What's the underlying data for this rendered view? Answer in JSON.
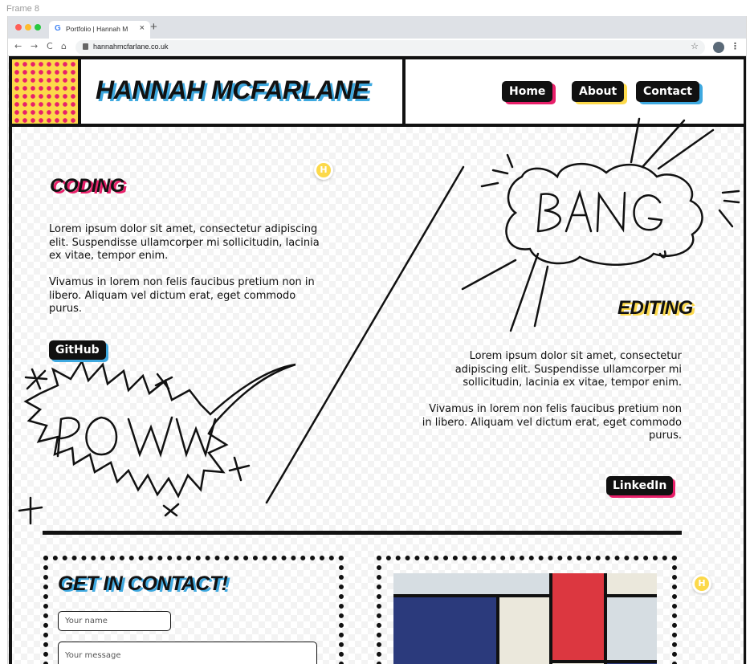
{
  "frame_label": "Frame 8",
  "browser": {
    "tab_title": "Portfolio | Hannah M",
    "tab_close": "×",
    "new_tab": "+",
    "url": "hannahmcfarlane.co.uk",
    "nav": {
      "back": "←",
      "forward": "→",
      "reload": "C",
      "home": "⌂",
      "star": "☆",
      "menu": "⋮"
    }
  },
  "header": {
    "site_title": "HANNAH MCFARLANE",
    "nav": [
      {
        "label": "Home"
      },
      {
        "label": "About"
      },
      {
        "label": "Contact"
      }
    ]
  },
  "coding": {
    "heading": "CODING",
    "para1": "Lorem ipsum dolor sit amet, consectetur adipiscing elit. Suspendisse ullamcorper mi sollicitudin, lacinia ex vitae, tempor enim.",
    "para2": "Vivamus in lorem non felis faucibus pretium non in libero. Aliquam vel dictum erat, eget commodo purus.",
    "button": "GitHub",
    "doodle_text": "POW"
  },
  "editing": {
    "heading": "EDITING",
    "para1": "Lorem ipsum dolor sit amet, consectetur adipiscing elit. Suspendisse ullamcorper mi sollicitudin, lacinia ex vitae, tempor enim.",
    "para2": "Vivamus in lorem non felis faucibus pretium non in libero. Aliquam vel dictum erat, eget commodo purus.",
    "button": "LinkedIn",
    "doodle_text": "BANG"
  },
  "contact": {
    "heading": "GET IN CONTACT!",
    "name_placeholder": "Your name",
    "message_placeholder": "Your message"
  },
  "markers": {
    "label": "H"
  },
  "colors": {
    "pink": "#e8206a",
    "yellow": "#fcd94a",
    "blue": "#3ea9e0",
    "mondrian_blue": "#2b3a7c",
    "mondrian_red": "#dc3740",
    "mondrian_cream": "#ebe8dc",
    "mondrian_grey": "#d6dde2"
  }
}
